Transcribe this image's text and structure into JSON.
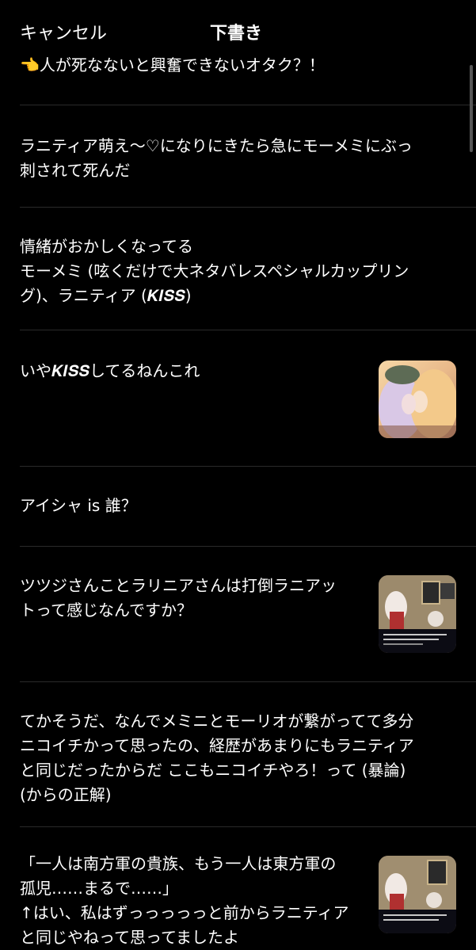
{
  "header": {
    "cancel_label": "キャンセル",
    "title": "下書き"
  },
  "drafts": [
    {
      "text": "👈人が死なないと興奮できないオタク？！",
      "has_image": false
    },
    {
      "text": "ラニティア萌え〜♡になりにきたら急にモーメミにぶっ\n刺されて死んだ",
      "has_image": false
    },
    {
      "text": "情緒がおかしくなってる\nモーメミ (呟くだけで大ネタバレスペシャルカップリン\nグ)、ラニティア (𝑲𝑰𝑺𝑺)",
      "has_image": false
    },
    {
      "text": "いや𝑲𝑰𝑺𝑺してるねんこれ",
      "has_image": true,
      "image_icon": "anime-kiss-illustration"
    },
    {
      "text": "アイシャ  is  誰？",
      "has_image": false
    },
    {
      "text": "ツツジさんことラリニアさんは打倒ラニアッ\nトって感じなんですか？",
      "has_image": true,
      "image_icon": "game-screenshot"
    },
    {
      "text": "てかそうだ、なんでメミニとモーリオが繋がってて多分\nニコイチかって思ったの、経歴があまりにもラニティア\nと同じだったからだ  ここもニコイチやろ！って (暴論)\n(からの正解)",
      "has_image": false
    },
    {
      "text": "「一人は南方軍の貴族、もう一人は東方軍の\n孤児……まるで……」\n↑はい、私はずっっっっっと前からラニティア\nと同じやねって思ってましたよ",
      "has_image": true,
      "image_icon": "game-screenshot"
    }
  ]
}
